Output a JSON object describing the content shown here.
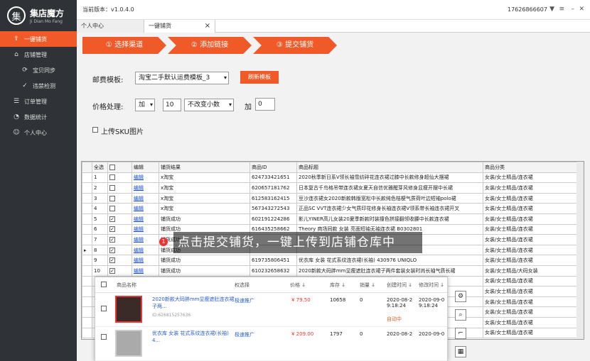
{
  "app": {
    "logo_mark": "集",
    "logo_name": "集店魔方",
    "logo_sub": "Ji Dian Mo Fang",
    "version": "当前版本：v1.0.4.0",
    "phone": "17626866607"
  },
  "sidebar": {
    "items": [
      {
        "label": "一键铺货",
        "icon": "upload-icon",
        "active": true
      },
      {
        "label": "店铺管理",
        "icon": "shop-icon"
      },
      {
        "label": "宝贝同步",
        "icon": "sync-icon",
        "sub": true
      },
      {
        "label": "违禁检测",
        "icon": "check-icon",
        "sub": true
      },
      {
        "label": "订单管理",
        "icon": "order-icon"
      },
      {
        "label": "数据统计",
        "icon": "stats-icon"
      },
      {
        "label": "个人中心",
        "icon": "user-icon"
      }
    ]
  },
  "tabs": [
    {
      "label": "个人中心"
    },
    {
      "label": "一键铺货",
      "close": "×"
    }
  ],
  "steps": [
    "① 选择渠道",
    "② 添加链接",
    "③ 提交铺货"
  ],
  "form": {
    "template_label": "邮费模板:",
    "template_value": "淘宝二手默认运费模板_3",
    "refresh_btn": "刷新模板",
    "price_label": "价格处理:",
    "op_value": "加",
    "num_value": "10",
    "mode_value": "不改变小数",
    "add_label": "加",
    "add_value": "0",
    "sku_label": "上传SKU图片"
  },
  "table": {
    "headers": [
      "",
      "全选",
      "",
      "编辑",
      "铺货结果",
      "商品ID",
      "商品标题",
      "商品分类"
    ],
    "rows": [
      {
        "n": "1",
        "chk": false,
        "edit": "编辑",
        "res": "x淘宝",
        "id": "624733421651",
        "title": "2020秋季新日系V领长袖雪纺碎花连衣裙过膝中长款修身超仙大摆裙",
        "cat": "女装/女士精品/连衣裙"
      },
      {
        "n": "2",
        "chk": false,
        "edit": "编辑",
        "res": "x淘宝",
        "id": "620657181762",
        "title": "日本复古千鸟格吊带连衣裙女夏天自信优雅醒芽风修身显瘦开摆中长裙",
        "cat": "女装/女士精品/连衣裙"
      },
      {
        "n": "3",
        "chk": false,
        "edit": "编辑",
        "res": "x淘宝",
        "id": "612583162415",
        "title": "豆沙连衣裙女2020新款韩版宽松中长款纯色桔梗气质荷叶边短袖polo裙",
        "cat": "女装/女士精品/连衣裙"
      },
      {
        "n": "4",
        "chk": false,
        "edit": "编辑",
        "res": "x淘宝",
        "id": "567343272543",
        "title": "正品SC VVT连衣裙少女气质印花修身长袖连衣裙V领系带长袖连衣裙开叉",
        "cat": "女装/女士精品/连衣裙"
      },
      {
        "n": "5",
        "chk": true,
        "edit": "编辑",
        "res": "铺货成功",
        "id": "602191224286",
        "title": "影儿YINER高儿女装20夏季新款时装撞色拼接翻领收腰中长款连衣裙",
        "cat": "女装/女士精品/连衣裙"
      },
      {
        "n": "6",
        "chk": true,
        "edit": "编辑",
        "res": "铺货成功",
        "id": "616435258662",
        "title": "Theory 商场同款 女装 亮面短袖无袖连衣裙 B0302801",
        "cat": "女装/女士精品/连衣裙"
      },
      {
        "n": "7",
        "chk": true,
        "edit": "编辑",
        "res": "铺货成功",
        "id": "",
        "title": "",
        "cat": "女装/女士精品/连衣裙"
      },
      {
        "n": "8",
        "chk": true,
        "edit": "编辑",
        "res": "铺货成功",
        "id": "",
        "title": "",
        "cat": "女装/女士精品/连衣裙"
      },
      {
        "n": "9",
        "chk": true,
        "edit": "编辑",
        "res": "铺货成功",
        "id": "619735806451",
        "title": "优衣库 女装 花式系纹连衣裙(长袖) 430976 UNIQLO",
        "cat": "女装/女士精品/连衣裙"
      },
      {
        "n": "10",
        "chk": true,
        "edit": "编辑",
        "res": "铺货成功",
        "id": "610232658632",
        "title": "2020新款大码胖mm显瘦遮肚连衣裙子两件套装女装时尚长袖气质长裙",
        "cat": "女装/女士精品/大码女装"
      },
      {
        "n": "",
        "chk": false,
        "edit": "",
        "res": "",
        "id": "",
        "title": "",
        "cat": "女装/女士精品/连衣裙"
      },
      {
        "n": "",
        "chk": false,
        "edit": "",
        "res": "",
        "id": "",
        "title": "",
        "cat": "女装/女士精品/连衣裙"
      },
      {
        "n": "",
        "chk": false,
        "edit": "",
        "res": "",
        "id": "",
        "title": "",
        "cat": "女装/女士精品/连衣裙"
      },
      {
        "n": "",
        "chk": false,
        "edit": "",
        "res": "",
        "id": "",
        "title": "",
        "cat": "女装/女士精品/连衣裙"
      },
      {
        "n": "",
        "chk": false,
        "edit": "",
        "res": "",
        "id": "",
        "title": "",
        "cat": "女装/女士精品/连衣裙"
      },
      {
        "n": "",
        "chk": false,
        "edit": "",
        "res": "",
        "id": "",
        "title": "",
        "cat": "女装/女士精品/连衣裙"
      }
    ]
  },
  "popup": {
    "head": {
      "name": "商品名称",
      "channel": "权选择",
      "price": "价格 ↓",
      "stock": "库存 ↓",
      "sales": "销量 ↓",
      "created": "创建时间 ↓",
      "updated": "修改时间 ↓"
    },
    "rows": [
      {
        "title": "2020新款大码胖mm显瘦遮肚连衣裙子两...",
        "sub": "ID:626815257636",
        "channel": "极速推广",
        "price": "¥ 79.50",
        "stock": "10658",
        "sales": "0",
        "created": "2020-08-2 9:18:24",
        "updated": "2020-09-0 9:18:24",
        "status": "自动中"
      },
      {
        "title": "优衣库 女装 花式系纹连衣裙(长袖) 4...",
        "sub": "",
        "channel": "极速推广",
        "price": "¥ 209.00",
        "stock": "1797",
        "sales": "0",
        "created": "2020-08-2",
        "updated": "2020-09-0",
        "status": ""
      }
    ]
  },
  "caption": "点击提交铺货，一键上传到店铺仓库中",
  "badge": "1"
}
